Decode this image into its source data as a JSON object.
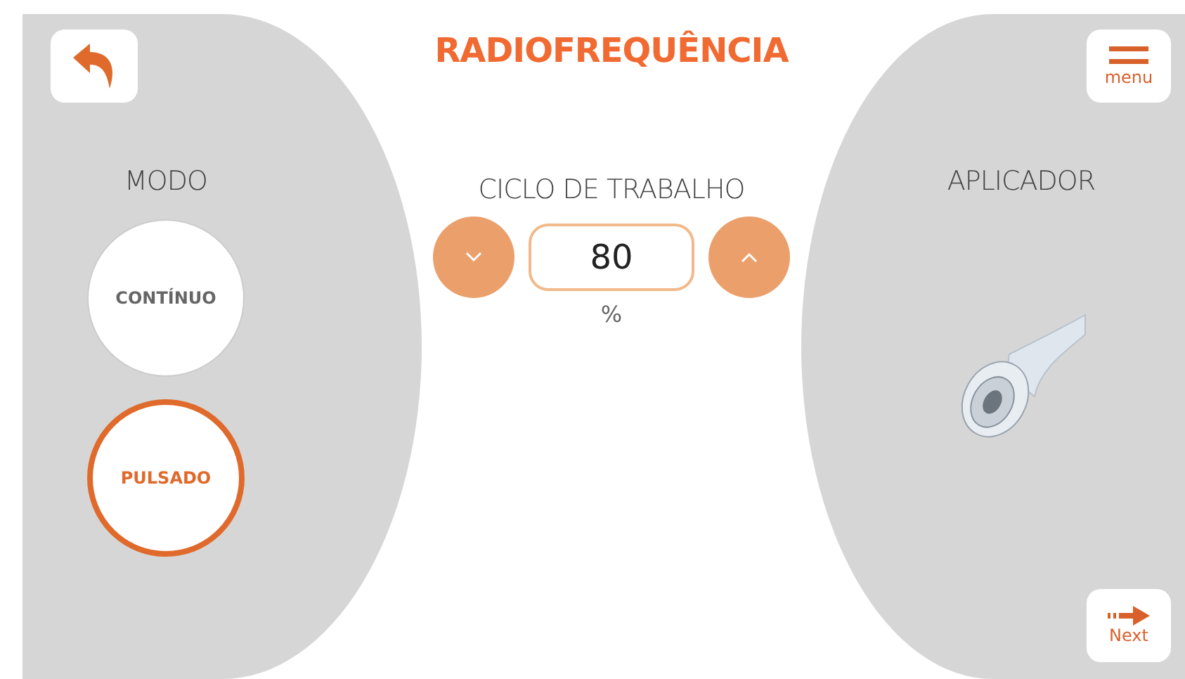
{
  "title": "RADIOFREQUÊNCIA",
  "menu_button": {
    "label": "menu"
  },
  "mode": {
    "title": "MODO",
    "options": [
      {
        "label": "CONTÍNUO",
        "selected": false
      },
      {
        "label": "PULSADO",
        "selected": true
      }
    ]
  },
  "duty_cycle": {
    "title": "CICLO DE TRABALHO",
    "value": "80",
    "unit": "%"
  },
  "applicator": {
    "title": "APLICADOR"
  },
  "next_button": {
    "label": "Next"
  }
}
